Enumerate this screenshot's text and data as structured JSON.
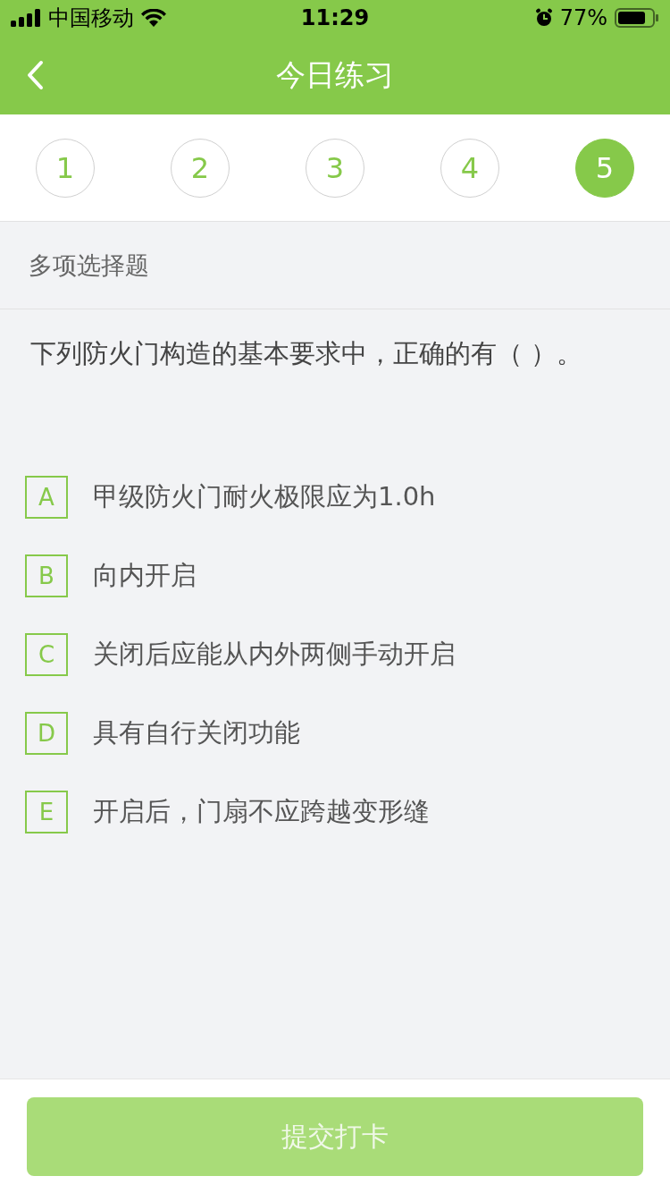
{
  "status_bar": {
    "carrier": "中国移动",
    "time": "11:29",
    "battery": "77%"
  },
  "nav": {
    "title": "今日练习"
  },
  "steps": [
    {
      "label": "1",
      "selected": false
    },
    {
      "label": "2",
      "selected": false
    },
    {
      "label": "3",
      "selected": false
    },
    {
      "label": "4",
      "selected": false
    },
    {
      "label": "5",
      "selected": true
    }
  ],
  "question_type": "多项选择题",
  "question": "下列防火门构造的基本要求中，正确的有（    ）。",
  "options": [
    {
      "letter": "A",
      "text": "甲级防火门耐火极限应为1.0h",
      "selected": false
    },
    {
      "letter": "B",
      "text": "向内开启",
      "selected": false
    },
    {
      "letter": "C",
      "text": "关闭后应能从内外两侧手动开启",
      "selected": false
    },
    {
      "letter": "D",
      "text": "具有自行关闭功能",
      "selected": false
    },
    {
      "letter": "E",
      "text": "开启后，门扇不应跨越变形缝",
      "selected": false
    }
  ],
  "submit": {
    "label": "提交打卡",
    "disabled": true
  }
}
